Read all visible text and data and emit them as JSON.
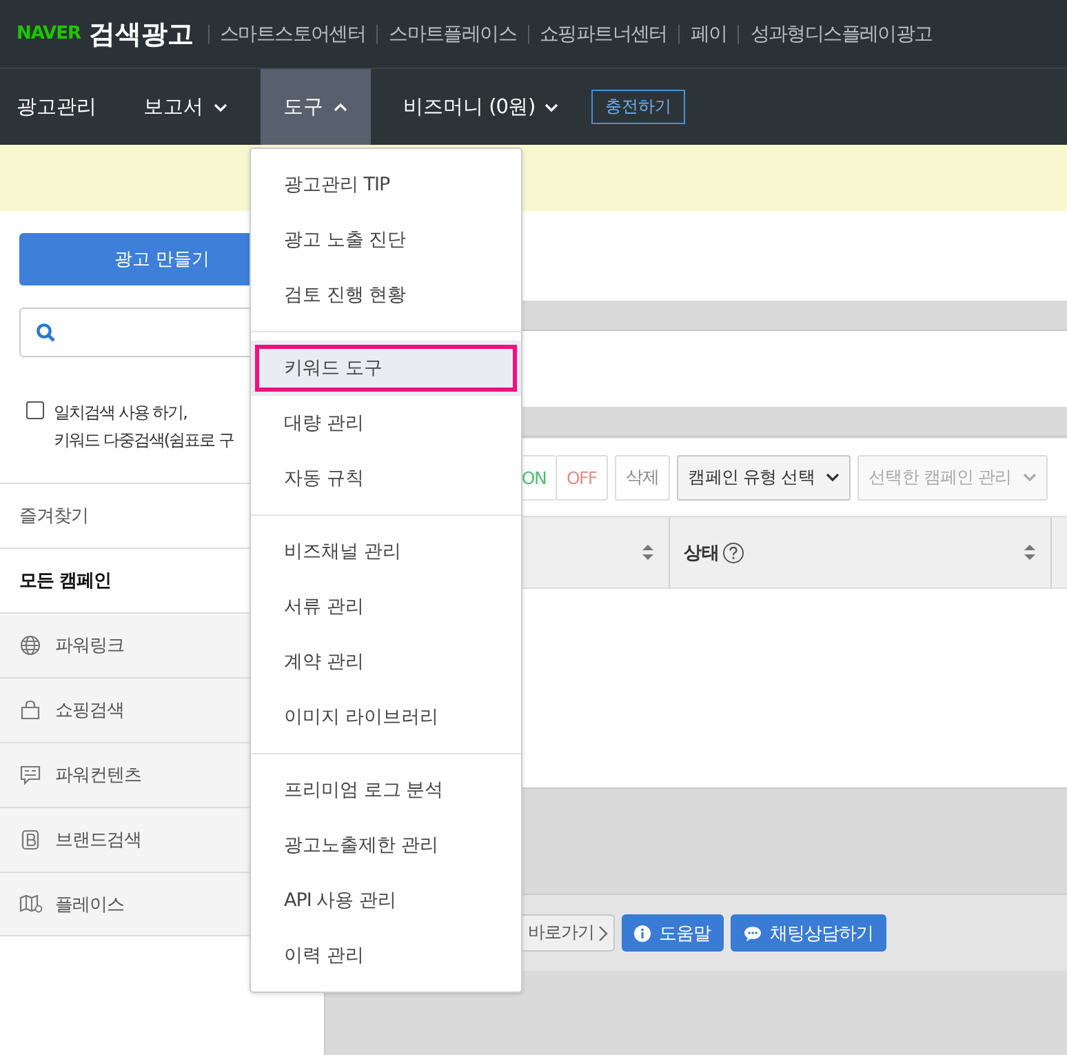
{
  "header": {
    "logo": "NAVER",
    "title": "검색광고",
    "links": [
      "스마트스토어센터",
      "스마트플레이스",
      "쇼핑파트너센터",
      "페이",
      "성과형디스플레이광고"
    ]
  },
  "nav": {
    "items": [
      {
        "label": "광고관리",
        "kind": "link",
        "selected": false
      },
      {
        "label": "보고서",
        "kind": "menu",
        "selected": false,
        "expanded": false
      },
      {
        "label": "도구",
        "kind": "menu",
        "selected": true,
        "expanded": true
      },
      {
        "label": "비즈머니 (0원)",
        "kind": "menu",
        "selected": false,
        "expanded": false
      }
    ],
    "charge_button": "충전하기"
  },
  "sidebar": {
    "create_button": "광고 만들기",
    "exact_match": {
      "checked": false,
      "lines": [
        "일치검색 사용 하기,",
        "키워드 다중검색(쉼표로 구"
      ]
    },
    "items": [
      {
        "label": "즐겨찾기",
        "kind": "plain",
        "selected": false
      },
      {
        "label": "모든 캠페인",
        "kind": "plain",
        "selected": true
      },
      {
        "label": "파워링크",
        "kind": "globe",
        "selected": false
      },
      {
        "label": "쇼핑검색",
        "kind": "bag",
        "selected": false
      },
      {
        "label": "파워컨텐츠",
        "kind": "chat",
        "selected": false
      },
      {
        "label": "브랜드검색",
        "kind": "brand",
        "selected": false
      },
      {
        "label": "플레이스",
        "kind": "map",
        "selected": false
      }
    ]
  },
  "toolbar": {
    "buttons": [
      {
        "label": "ON",
        "kind": "on"
      },
      {
        "label": "OFF",
        "kind": "off"
      },
      {
        "label": "삭제",
        "kind": "plain"
      },
      {
        "label": "캠페인 유형 선택",
        "kind": "select"
      },
      {
        "label": "선택한 캠페인 관리",
        "kind": "select-disabled"
      }
    ]
  },
  "table": {
    "columns": [
      {
        "label": "상태",
        "help": true
      }
    ]
  },
  "footer_buttons": [
    {
      "label": "바로가기",
      "kind": "link"
    },
    {
      "label": "도움말",
      "kind": "help"
    },
    {
      "label": "채팅상담하기",
      "kind": "chat"
    }
  ],
  "dropdown": {
    "sections": [
      [
        {
          "label": "광고관리 TIP",
          "selected": false
        },
        {
          "label": "광고 노출 진단",
          "selected": false
        },
        {
          "label": "검토 진행 현황",
          "selected": false
        }
      ],
      [
        {
          "label": "키워드 도구",
          "selected": true
        },
        {
          "label": "대량 관리",
          "selected": false
        },
        {
          "label": "자동 규칙",
          "selected": false
        }
      ],
      [
        {
          "label": "비즈채널 관리",
          "selected": false
        },
        {
          "label": "서류 관리",
          "selected": false
        },
        {
          "label": "계약 관리",
          "selected": false
        },
        {
          "label": "이미지 라이브러리",
          "selected": false
        }
      ],
      [
        {
          "label": "프리미엄 로그 분석",
          "selected": false
        },
        {
          "label": "광고노출제한 관리",
          "selected": false
        },
        {
          "label": "API 사용 관리",
          "selected": false
        },
        {
          "label": "이력 관리",
          "selected": false
        }
      ]
    ]
  }
}
